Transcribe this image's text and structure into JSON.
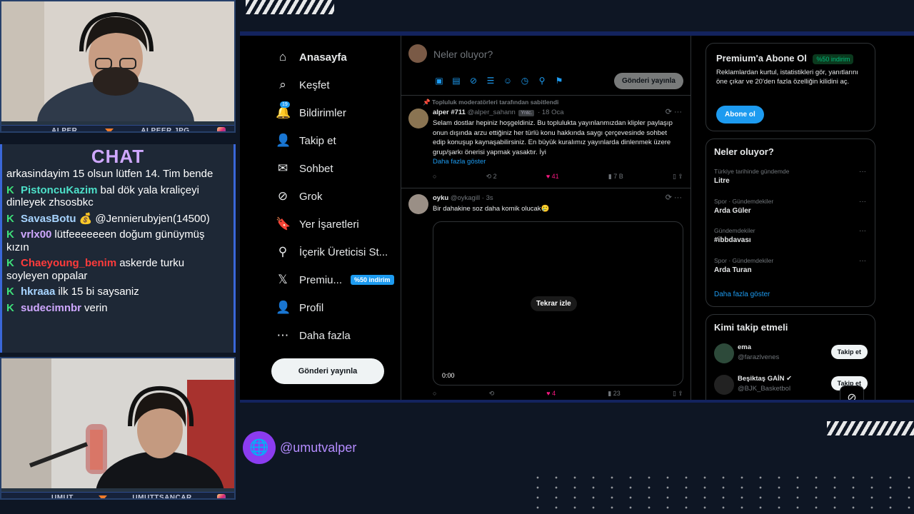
{
  "overlay": {
    "cam_top": {
      "left_name": "ALPER",
      "right_name": "ALPEER.JPG"
    },
    "cam_bottom": {
      "left_name": "UMUT",
      "right_name": "UMUTTSANCAR"
    },
    "chat_title": "CHAT",
    "chat_messages": [
      {
        "badge": "",
        "user": "",
        "user_color": "#ffffff",
        "text": "arkasindayim 15 olsun lütfen 14. Tim bende"
      },
      {
        "badge": "K",
        "user": "PistoncuKazim",
        "user_color": "#4de0c9",
        "text": "bal dök yala kraliçeyi dinleyek zhsosbkc"
      },
      {
        "badge": "K",
        "user": "SavasBotu",
        "user_color": "#a7d4ff",
        "text": "💰 @Jennierubyjen(14500)"
      },
      {
        "badge": "K",
        "user": "vrlx00",
        "user_color": "#cfa8ff",
        "text": "lütfeeeeeeen doğum günüymüş kızın"
      },
      {
        "badge": "K",
        "user": "Chaeyoung_benim",
        "user_color": "#ff3b3b",
        "text": "askerde turku soyleyen oppalar"
      },
      {
        "badge": "K",
        "user": "hkraaa",
        "user_color": "#a7d4ff",
        "text": "ilk 15 bi saysaniz"
      },
      {
        "badge": "K",
        "user": "sudecimnbr",
        "user_color": "#cfa8ff",
        "text": "verin"
      }
    ],
    "handle": "@umutvalper"
  },
  "sidebar": {
    "items": [
      {
        "icon": "home-icon",
        "glyph": "⌂",
        "label": "Anasayfa"
      },
      {
        "icon": "search-icon",
        "glyph": "⌕",
        "label": "Keşfet"
      },
      {
        "icon": "bell-icon",
        "glyph": "🔔",
        "label": "Bildirimler",
        "badge": "19"
      },
      {
        "icon": "follow-icon",
        "glyph": "👤",
        "label": "Takip et"
      },
      {
        "icon": "mail-icon",
        "glyph": "✉",
        "label": "Sohbet"
      },
      {
        "icon": "grok-icon",
        "glyph": "⊘",
        "label": "Grok"
      },
      {
        "icon": "bookmark-icon",
        "glyph": "🔖",
        "label": "Yer İşaretleri"
      },
      {
        "icon": "creator-icon",
        "glyph": "⚲",
        "label": "İçerik Üreticisi St..."
      },
      {
        "icon": "x-logo-icon",
        "glyph": "𝕏",
        "label": "Premiu...",
        "promo": "%50 indirim"
      },
      {
        "icon": "profile-icon",
        "glyph": "👤",
        "label": "Profil"
      },
      {
        "icon": "more-icon",
        "glyph": "⋯",
        "label": "Daha fazla"
      }
    ],
    "post_button": "Gönderi yayınla"
  },
  "composer": {
    "placeholder": "Neler oluyor?",
    "share_button": "Gönderi yayınla"
  },
  "tweets": [
    {
      "pinned": "Topluluk moderatörleri tarafından sabitlendi",
      "name": "alper #711",
      "handle": "@alper_sahann",
      "tag": "Yntc.",
      "time": "· 18 Oca",
      "text": "Selam dostlar hepiniz hoşgeldiniz. Bu toplulukta yayınlanmızdan klipler paylaşıp onun dışında arzu ettiğiniz her türlü konu hakkında saygı çerçevesinde sohbet edip konuşup kaynaşabilirsiniz. En büyük kuralımız yayınlarda dinlenmek üzere grup/şarkı önerisi yapmak yasaktır. İyi",
      "show_more": "Daha fazla göster",
      "retweets": "2",
      "likes": "41",
      "views": "7 B"
    },
    {
      "name": "oyku",
      "handle": "@oykagill",
      "time": "· 3s",
      "text": "Bir dahakine soz daha komik olucak🥲",
      "video_replay": "Tekrar izle",
      "video_time": "0:00",
      "likes": "4",
      "views": "23"
    }
  ],
  "premium_card": {
    "title": "Premium'a Abone Ol",
    "pill": "%50 indirim",
    "text": "Reklamlardan kurtul, istatistikleri gör, yanıtlarını öne çıkar ve 20'den fazla özelliğin kilidini aç.",
    "button": "Abone ol"
  },
  "trends_card": {
    "title": "Neler oluyor?",
    "items": [
      {
        "context": "Türkiye tarihinde gündemde",
        "topic": "Litre"
      },
      {
        "context": "Spor · Gündemdekiler",
        "topic": "Arda Güler"
      },
      {
        "context": "Gündemdekiler",
        "topic": "#ibbdavası"
      },
      {
        "context": "Spor · Gündemdekiler",
        "topic": "Arda Turan"
      }
    ],
    "show_more": "Daha fazla göster"
  },
  "follow_card": {
    "title": "Kimi takip etmeli",
    "items": [
      {
        "name": "ema",
        "handle": "@farazlvenes",
        "button": "Takip et"
      },
      {
        "name": "Beşiktaş GAİN ✔",
        "handle": "@BJK_Basketbol",
        "button": "Takip et"
      }
    ]
  },
  "colors": {
    "accent": "#1d9bf0",
    "like": "#f91880",
    "overlay_purple": "#8b3cf0"
  }
}
